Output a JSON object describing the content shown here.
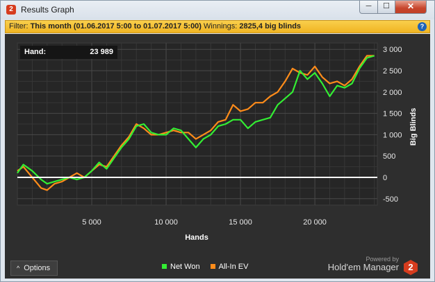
{
  "window": {
    "title": "Results Graph",
    "app_icon": "2",
    "buttons": {
      "minimize": "─",
      "maximize": "☐",
      "close": "✕"
    }
  },
  "filter": {
    "label": "Filter:",
    "value": "This month (01.06.2017 5:00 to 01.07.2017 5:00)",
    "winnings_label": "Winnings:",
    "winnings_value": "2825,4 big blinds",
    "help_icon": "?"
  },
  "hover_box": {
    "label": "Hand:",
    "value": "23 989"
  },
  "chart_data": {
    "type": "line",
    "xlabel": "Hands",
    "ylabel": "Big Blinds",
    "xlim": [
      0,
      24200
    ],
    "ylim": [
      -650,
      3150
    ],
    "x_ticks": [
      5000,
      10000,
      15000,
      20000
    ],
    "x_tick_labels": [
      "5 000",
      "10 000",
      "15 000",
      "20 000"
    ],
    "y_ticks": [
      -500,
      0,
      500,
      1000,
      1500,
      2000,
      2500,
      3000
    ],
    "y_tick_labels": [
      "-500",
      "0",
      "500",
      "1 000",
      "1 500",
      "2 000",
      "2 500",
      "3 000"
    ],
    "grid": true,
    "zero_line": true,
    "series": [
      {
        "name": "Net Won",
        "color": "#33ee33",
        "x": [
          0,
          400,
          1000,
          1600,
          2000,
          2500,
          3000,
          3500,
          4000,
          4500,
          5000,
          5500,
          6000,
          6500,
          7000,
          7500,
          8000,
          8500,
          9000,
          9500,
          10000,
          10500,
          11000,
          11500,
          12000,
          12500,
          13000,
          13500,
          14000,
          14500,
          15000,
          15500,
          16000,
          16500,
          17000,
          17500,
          18000,
          18500,
          19000,
          19500,
          20000,
          20500,
          21000,
          21500,
          22000,
          22500,
          23000,
          23500,
          24000
        ],
        "values": [
          100,
          300,
          150,
          -50,
          -150,
          -100,
          -50,
          0,
          -50,
          0,
          150,
          350,
          200,
          450,
          700,
          900,
          1200,
          1250,
          1050,
          1000,
          1000,
          1150,
          1100,
          900,
          700,
          900,
          1000,
          1200,
          1250,
          1350,
          1350,
          1150,
          1300,
          1350,
          1400,
          1700,
          1850,
          2000,
          2500,
          2300,
          2450,
          2200,
          1900,
          2150,
          2100,
          2200,
          2550,
          2800,
          2850
        ]
      },
      {
        "name": "All-In EV",
        "color": "#ff8c1a",
        "x": [
          0,
          400,
          1000,
          1600,
          2000,
          2500,
          3000,
          3500,
          4000,
          4500,
          5000,
          5500,
          6000,
          6500,
          7000,
          7500,
          8000,
          8500,
          9000,
          9500,
          10000,
          10500,
          11000,
          11500,
          12000,
          12500,
          13000,
          13500,
          14000,
          14500,
          15000,
          15500,
          16000,
          16500,
          17000,
          17500,
          18000,
          18500,
          19000,
          19500,
          20000,
          20500,
          21000,
          21500,
          22000,
          22500,
          23000,
          23500,
          24000
        ],
        "values": [
          150,
          250,
          0,
          -250,
          -300,
          -150,
          -100,
          0,
          100,
          0,
          150,
          300,
          250,
          500,
          750,
          950,
          1250,
          1150,
          1000,
          1000,
          1050,
          1100,
          1050,
          1050,
          900,
          1000,
          1100,
          1300,
          1350,
          1700,
          1550,
          1600,
          1750,
          1750,
          1900,
          2000,
          2250,
          2550,
          2450,
          2400,
          2600,
          2350,
          2200,
          2250,
          2150,
          2300,
          2600,
          2850,
          2850
        ]
      }
    ]
  },
  "legend": {
    "net_won": "Net Won",
    "all_in_ev": "All-In EV"
  },
  "options": {
    "chevron": "^",
    "label": "Options"
  },
  "brand": {
    "powered_by": "Powered by",
    "name": "Hold'em Manager",
    "logo": "2"
  },
  "colors": {
    "filter_bg": "#f4c032",
    "panel_bg": "#2e2e2e",
    "plot_bg": "#252525",
    "net_won": "#33ee33",
    "all_in_ev": "#ff8c1a"
  }
}
